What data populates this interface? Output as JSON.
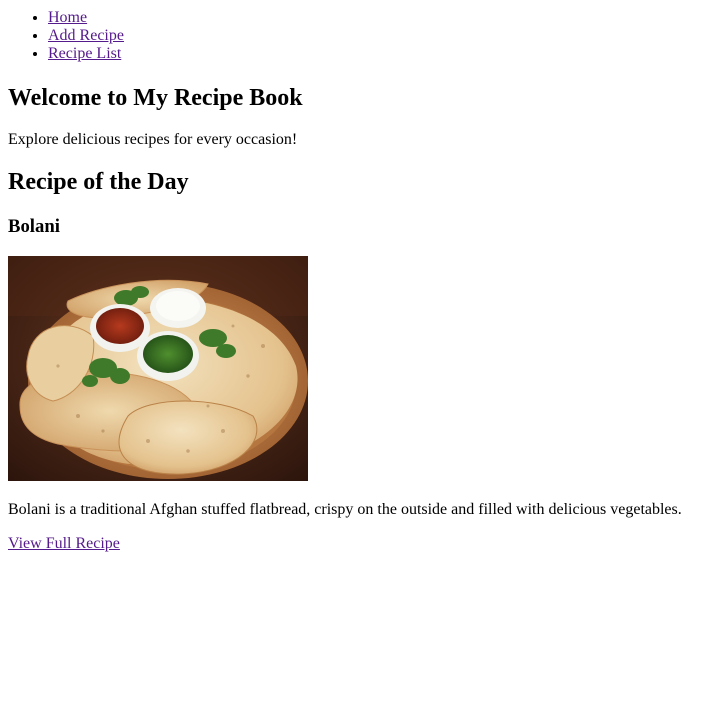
{
  "nav": {
    "items": [
      {
        "label": "Home"
      },
      {
        "label": "Add Recipe"
      },
      {
        "label": "Recipe List"
      }
    ]
  },
  "header": {
    "title": "Welcome to My Recipe Book",
    "subtitle": "Explore delicious recipes for every occasion!"
  },
  "featured": {
    "section_title": "Recipe of the Day",
    "recipe_name": "Bolani",
    "image_alt": "Bolani",
    "description": "Bolani is a traditional Afghan stuffed flatbread, crispy on the outside and filled with delicious vegetables.",
    "link_label": "View Full Recipe"
  },
  "colors": {
    "link_visited": "#551a8b",
    "text": "#000000",
    "background": "#ffffff"
  }
}
